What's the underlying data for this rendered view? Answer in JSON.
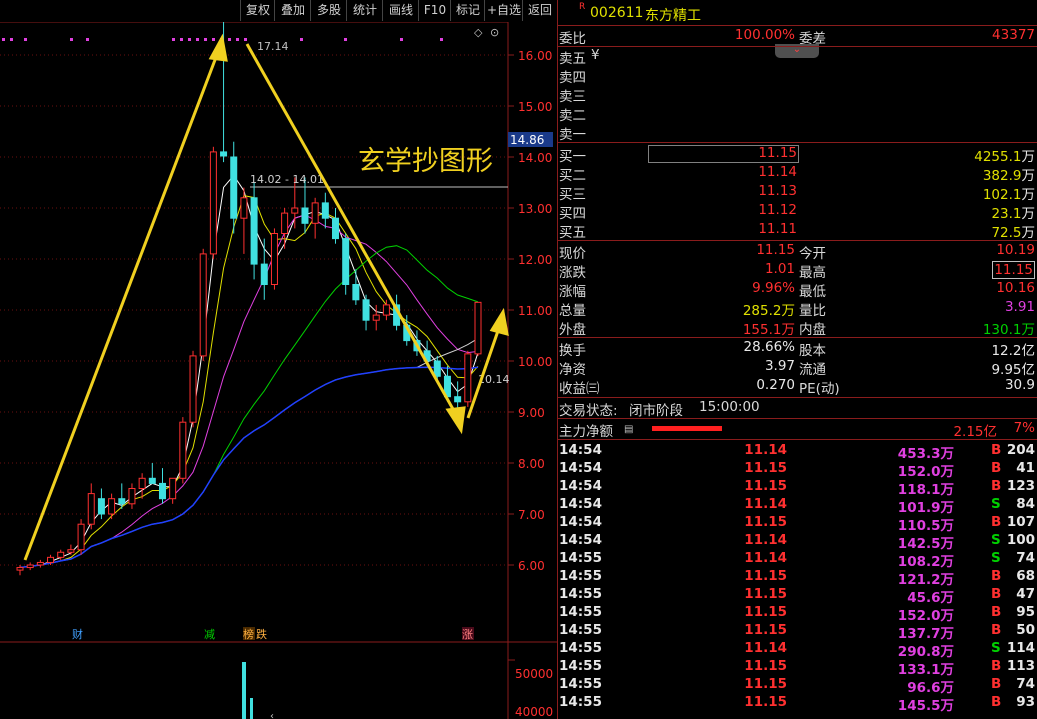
{
  "toolbar": {
    "buttons": [
      "复权",
      "叠加",
      "多股",
      "统计",
      "画线",
      "F10",
      "标记",
      "+自选",
      "返回"
    ]
  },
  "chart": {
    "price_ticks": [
      "16.00",
      "15.00",
      "14.00",
      "13.00",
      "12.00",
      "11.00",
      "10.00",
      "9.00",
      "8.00",
      "7.00",
      "6.00"
    ],
    "current_price_tag": "14.86",
    "high_label": "17.14",
    "range_label": "14.02 - 14.01",
    "last_label": "10.14",
    "watermark": "玄学抄图形",
    "events": [
      "财",
      "减",
      "榜",
      "跌",
      "涨"
    ],
    "volume_ticks": [
      "50000",
      "40000"
    ]
  },
  "chart_data": {
    "type": "candlestick",
    "title": "",
    "ylim": [
      5.6,
      17.3
    ],
    "candles": [
      [
        5.9,
        6.0,
        5.8,
        5.95
      ],
      [
        5.95,
        6.05,
        5.9,
        6.0
      ],
      [
        6.0,
        6.1,
        5.95,
        6.05
      ],
      [
        6.05,
        6.2,
        6.0,
        6.15
      ],
      [
        6.15,
        6.3,
        6.1,
        6.25
      ],
      [
        6.25,
        6.4,
        6.2,
        6.3
      ],
      [
        6.3,
        6.9,
        6.2,
        6.8
      ],
      [
        6.8,
        7.6,
        6.7,
        7.4
      ],
      [
        7.3,
        7.5,
        6.9,
        7.0
      ],
      [
        7.0,
        7.4,
        6.9,
        7.3
      ],
      [
        7.3,
        7.6,
        7.1,
        7.2
      ],
      [
        7.2,
        7.6,
        7.1,
        7.5
      ],
      [
        7.5,
        7.8,
        7.3,
        7.7
      ],
      [
        7.7,
        8.0,
        7.6,
        7.6
      ],
      [
        7.6,
        7.9,
        7.2,
        7.3
      ],
      [
        7.3,
        7.7,
        7.2,
        7.7
      ],
      [
        7.7,
        8.9,
        7.6,
        8.8
      ],
      [
        8.8,
        10.2,
        8.7,
        10.1
      ],
      [
        10.1,
        12.2,
        10.0,
        12.1
      ],
      [
        12.1,
        14.2,
        12.0,
        14.1
      ],
      [
        14.1,
        17.14,
        13.9,
        14.02
      ],
      [
        14.0,
        14.3,
        12.5,
        12.8
      ],
      [
        12.8,
        13.4,
        12.1,
        13.2
      ],
      [
        13.2,
        13.5,
        11.6,
        11.9
      ],
      [
        11.9,
        12.4,
        11.2,
        11.5
      ],
      [
        11.5,
        12.6,
        11.4,
        12.5
      ],
      [
        12.5,
        13.0,
        12.2,
        12.9
      ],
      [
        12.9,
        13.6,
        12.6,
        13.0
      ],
      [
        13.0,
        13.6,
        12.5,
        12.7
      ],
      [
        12.7,
        13.2,
        12.4,
        13.1
      ],
      [
        13.1,
        13.3,
        12.6,
        12.8
      ],
      [
        12.8,
        13.0,
        12.3,
        12.4
      ],
      [
        12.4,
        12.5,
        11.3,
        11.5
      ],
      [
        11.5,
        11.8,
        11.1,
        11.2
      ],
      [
        11.2,
        11.3,
        10.6,
        10.8
      ],
      [
        10.8,
        11.1,
        10.6,
        10.9
      ],
      [
        10.9,
        11.2,
        10.8,
        11.1
      ],
      [
        11.1,
        11.3,
        10.6,
        10.7
      ],
      [
        10.7,
        10.9,
        10.3,
        10.4
      ],
      [
        10.4,
        10.6,
        10.1,
        10.2
      ],
      [
        10.2,
        10.4,
        9.9,
        10.0
      ],
      [
        10.0,
        10.1,
        9.6,
        9.7
      ],
      [
        9.7,
        9.9,
        9.2,
        9.3
      ],
      [
        9.3,
        9.6,
        9.0,
        9.2
      ],
      [
        9.2,
        10.2,
        9.1,
        10.14
      ],
      [
        10.14,
        11.15,
        10.1,
        11.15
      ]
    ],
    "ma_colors": [
      "#ffffff",
      "#e0e000",
      "#e040e0",
      "#00d000",
      "#d0d0d0",
      "#2040ff"
    ]
  },
  "quote": {
    "code": "002611",
    "name": "东方精工",
    "weibi_label": "委比",
    "weibi_value": "100.00%",
    "weicha_label": "委差",
    "weicha_value": "43377",
    "sell_labels": [
      "卖五",
      "卖四",
      "卖三",
      "卖二",
      "卖一"
    ],
    "sell_currency": "¥",
    "buy": [
      {
        "label": "买一",
        "price": "11.15",
        "vol": "4255.1",
        "unit": "万"
      },
      {
        "label": "买二",
        "price": "11.14",
        "vol": "382.9",
        "unit": "万"
      },
      {
        "label": "买三",
        "price": "11.13",
        "vol": "102.1",
        "unit": "万"
      },
      {
        "label": "买四",
        "price": "11.12",
        "vol": "23.1",
        "unit": "万"
      },
      {
        "label": "买五",
        "price": "11.11",
        "vol": "72.5",
        "unit": "万"
      }
    ],
    "stats": [
      {
        "l1": "现价",
        "v1": "11.15",
        "c1": "red",
        "l2": "今开",
        "v2": "10.19",
        "c2": "red"
      },
      {
        "l1": "涨跌",
        "v1": "1.01",
        "c1": "red",
        "l2": "最高",
        "v2": "11.15",
        "c2": "red"
      },
      {
        "l1": "涨幅",
        "v1": "9.96%",
        "c1": "red",
        "l2": "最低",
        "v2": "10.16",
        "c2": "red"
      },
      {
        "l1": "总量",
        "v1": "285.2万",
        "c1": "yel",
        "l2": "量比",
        "v2": "3.91",
        "c2": "mag"
      },
      {
        "l1": "外盘",
        "v1": "155.1万",
        "c1": "red",
        "l2": "内盘",
        "v2": "130.1万",
        "c2": "grn"
      }
    ],
    "stats2": [
      {
        "l1": "换手",
        "v1": "28.66%",
        "l2": "股本",
        "v2": "12.2亿"
      },
      {
        "l1": "净资",
        "v1": "3.97",
        "l2": "流通",
        "v2": "9.95亿"
      },
      {
        "l1": "收益㈢",
        "v1": "0.270",
        "l2": "PE(动)",
        "v2": "30.9"
      }
    ],
    "trade_status_label": "交易状态:",
    "trade_status_value": "闭市阶段",
    "trade_status_time": "15:00:00",
    "main_flow_label": "主力净额",
    "main_flow_value": "2.15亿",
    "main_flow_pct": "7%"
  },
  "ticks": [
    {
      "t": "14:54",
      "p": "11.14",
      "v": "453.3万",
      "s": "B",
      "n": "204"
    },
    {
      "t": "14:54",
      "p": "11.15",
      "v": "152.0万",
      "s": "B",
      "n": "41"
    },
    {
      "t": "14:54",
      "p": "11.15",
      "v": "118.1万",
      "s": "B",
      "n": "123"
    },
    {
      "t": "14:54",
      "p": "11.14",
      "v": "101.9万",
      "s": "S",
      "n": "84"
    },
    {
      "t": "14:54",
      "p": "11.15",
      "v": "110.5万",
      "s": "B",
      "n": "107"
    },
    {
      "t": "14:54",
      "p": "11.14",
      "v": "142.5万",
      "s": "S",
      "n": "100"
    },
    {
      "t": "14:55",
      "p": "11.14",
      "v": "108.2万",
      "s": "S",
      "n": "74"
    },
    {
      "t": "14:55",
      "p": "11.15",
      "v": "121.2万",
      "s": "B",
      "n": "68"
    },
    {
      "t": "14:55",
      "p": "11.15",
      "v": "45.6万",
      "s": "B",
      "n": "47"
    },
    {
      "t": "14:55",
      "p": "11.15",
      "v": "152.0万",
      "s": "B",
      "n": "95"
    },
    {
      "t": "14:55",
      "p": "11.15",
      "v": "137.7万",
      "s": "B",
      "n": "50"
    },
    {
      "t": "14:55",
      "p": "11.14",
      "v": "290.8万",
      "s": "S",
      "n": "114"
    },
    {
      "t": "14:55",
      "p": "11.15",
      "v": "133.1万",
      "s": "B",
      "n": "113"
    },
    {
      "t": "14:55",
      "p": "11.15",
      "v": "96.6万",
      "s": "B",
      "n": "74"
    },
    {
      "t": "14:55",
      "p": "11.15",
      "v": "145.5万",
      "s": "B",
      "n": "93"
    }
  ]
}
